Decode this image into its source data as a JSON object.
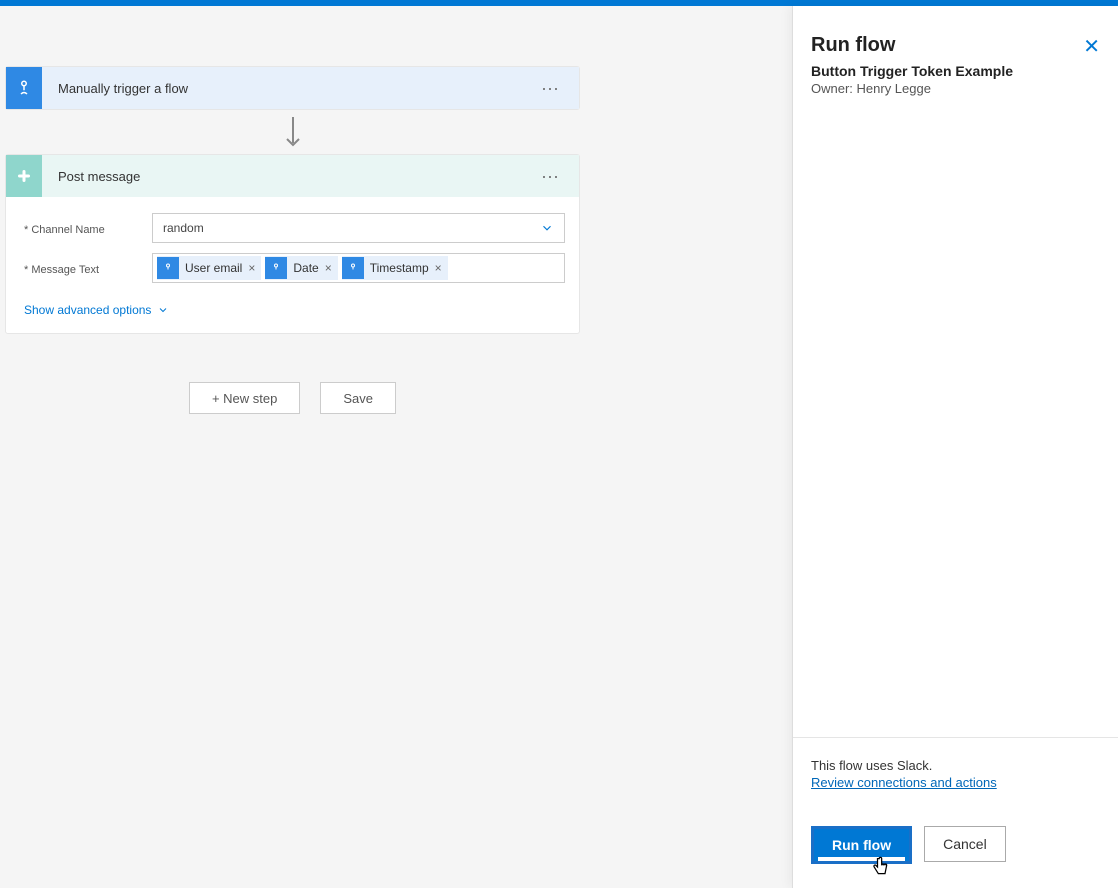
{
  "trigger": {
    "title": "Manually trigger a flow"
  },
  "action": {
    "title": "Post message",
    "fields": {
      "channelLabel": "* Channel Name",
      "channelValue": "random",
      "messageLabel": "* Message Text"
    },
    "tokens": [
      {
        "label": "User email"
      },
      {
        "label": "Date"
      },
      {
        "label": "Timestamp"
      }
    ],
    "advancedToggle": "Show advanced options"
  },
  "canvasButtons": {
    "newStep": "+ New step",
    "save": "Save"
  },
  "panel": {
    "title": "Run flow",
    "subtitle": "Button Trigger Token Example",
    "owner": "Owner: Henry Legge",
    "footerText": "This flow uses Slack.",
    "reviewLink": "Review connections and actions",
    "runBtn": "Run flow",
    "cancelBtn": "Cancel"
  }
}
